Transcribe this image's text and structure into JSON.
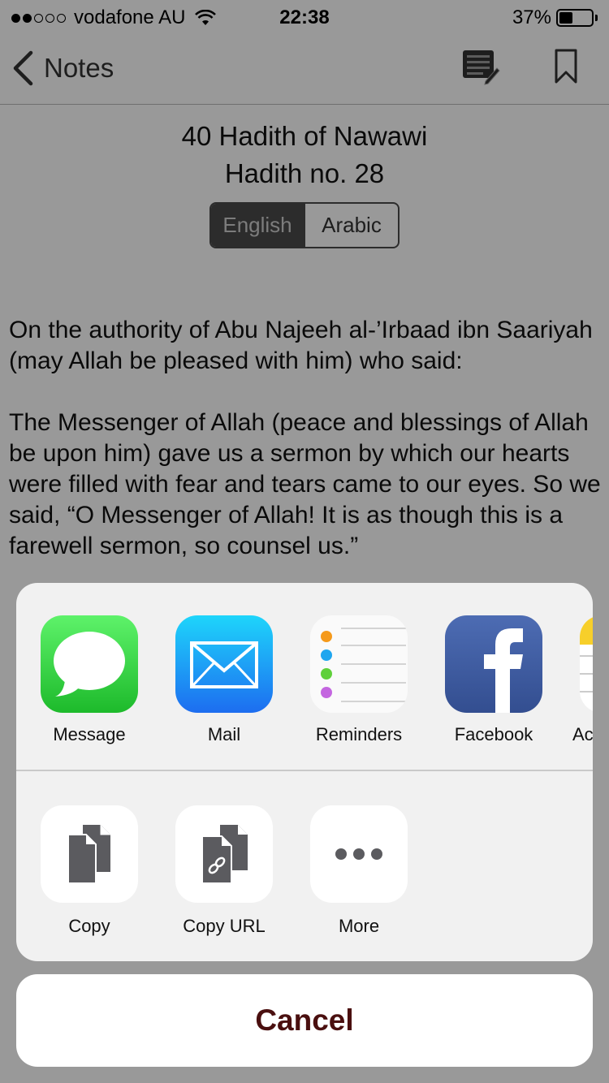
{
  "status_bar": {
    "carrier": "vodafone AU",
    "time": "22:38",
    "battery": "37%",
    "battery_level": 0.37,
    "signal_bars": 2
  },
  "nav": {
    "back_label": "Notes",
    "icons": [
      "chevron-left-icon",
      "notes-list-icon",
      "bookmark-icon"
    ]
  },
  "header": {
    "title": "40 Hadith of Nawawi",
    "subtitle": "Hadith no. 28"
  },
  "language_toggle": {
    "english": "English",
    "arabic": "Arabic",
    "selected": "English"
  },
  "hadith": {
    "paragraph1": "On the authority of Abu Najeeh al-’Irbaad ibn Saariyah (may Allah be pleased with him) who said:",
    "paragraph2": "The Messenger of Allah (peace and blessings of Allah be upon him) gave us a sermon by which our hearts were filled with fear and tears came to our eyes. So we said, “O Messenger of Allah! It is as though this is a farewell sermon, so counsel us.”"
  },
  "share_sheet": {
    "apps": [
      {
        "label": "Message",
        "icon": "message-icon"
      },
      {
        "label": "Mail",
        "icon": "mail-icon"
      },
      {
        "label": "Reminders",
        "icon": "reminders-icon"
      },
      {
        "label": "Facebook",
        "icon": "facebook-icon"
      },
      {
        "label": "Ac",
        "icon": "notes-app-icon"
      }
    ],
    "actions": [
      {
        "label": "Copy",
        "icon": "copy-icon"
      },
      {
        "label": "Copy URL",
        "icon": "copy-url-icon"
      },
      {
        "label": "More",
        "icon": "more-icon"
      }
    ],
    "cancel": "Cancel"
  },
  "colors": {
    "message_green": "#2fcc3c",
    "mail_blue": "#1a8ef5",
    "facebook_blue": "#3b5998",
    "cancel_text": "#4a0f0f",
    "segment_active": "#4a4a4a"
  }
}
